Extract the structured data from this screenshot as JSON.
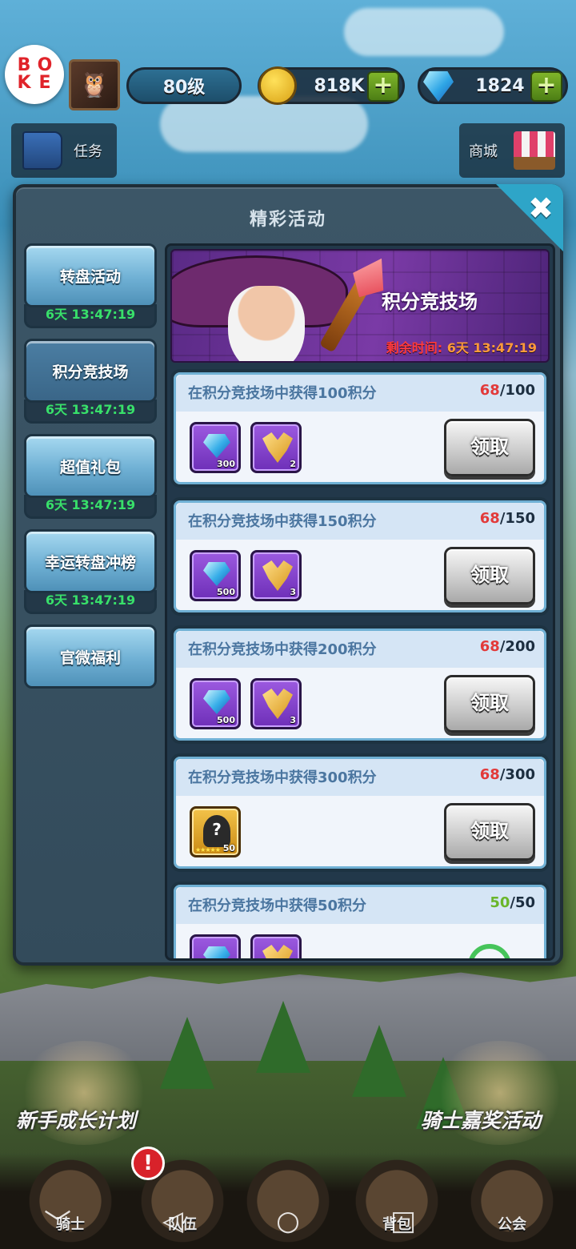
{
  "top_bar": {
    "logo_text": "BOKE",
    "level": "80级",
    "coins": "818K",
    "gems": "1824",
    "plus_symbol": "+",
    "task_label": "任务",
    "shop_label": "商城"
  },
  "panel": {
    "title": "精彩活动",
    "close_symbol": "✖"
  },
  "tabs": [
    {
      "label": "转盘活动",
      "timer": "6天 13:47:19"
    },
    {
      "label": "积分竞技场",
      "timer": "6天 13:47:19"
    },
    {
      "label": "超值礼包",
      "timer": "6天 13:47:19"
    },
    {
      "label": "幸运转盘冲榜",
      "timer": "6天 13:47:19"
    },
    {
      "label": "官微福利"
    }
  ],
  "banner": {
    "title": "积分竞技场",
    "remaining_label": "剩余时间:",
    "remaining_time": "6天 13:47:19"
  },
  "quests": [
    {
      "title": "在积分竞技场中获得100积分",
      "current": "68",
      "target": "/100",
      "rewards": [
        "300",
        "2"
      ],
      "button": "领取"
    },
    {
      "title": "在积分竞技场中获得150积分",
      "current": "68",
      "target": "/150",
      "rewards": [
        "500",
        "3"
      ],
      "button": "领取"
    },
    {
      "title": "在积分竞技场中获得200积分",
      "current": "68",
      "target": "/200",
      "rewards": [
        "500",
        "3"
      ],
      "button": "领取"
    },
    {
      "title": "在积分竞技场中获得300积分",
      "current": "68",
      "target": "/300",
      "rewards": [
        "50"
      ],
      "button": "领取"
    },
    {
      "title": "在积分竞技场中获得50积分",
      "current": "50",
      "target": "/50"
    }
  ],
  "hero_reward_symbol": "?",
  "hero_stars": "★★★★★",
  "promos": {
    "left": "新手成长计划",
    "right": "骑士嘉奖活动"
  },
  "bottom_nav": [
    {
      "label": "骑士"
    },
    {
      "label": "队伍"
    },
    {
      "label": ""
    },
    {
      "label": "背包"
    },
    {
      "label": "公会"
    }
  ],
  "alert_symbol": "!",
  "system_nav": {
    "back": "◁",
    "home": "○",
    "recent": "□",
    "hide": "﹀"
  },
  "colors": {
    "progress_incomplete": "#e23a3a",
    "progress_complete": "#6ab62a",
    "timer_green": "#38e06a",
    "accent_blue": "#2ea5c8"
  }
}
